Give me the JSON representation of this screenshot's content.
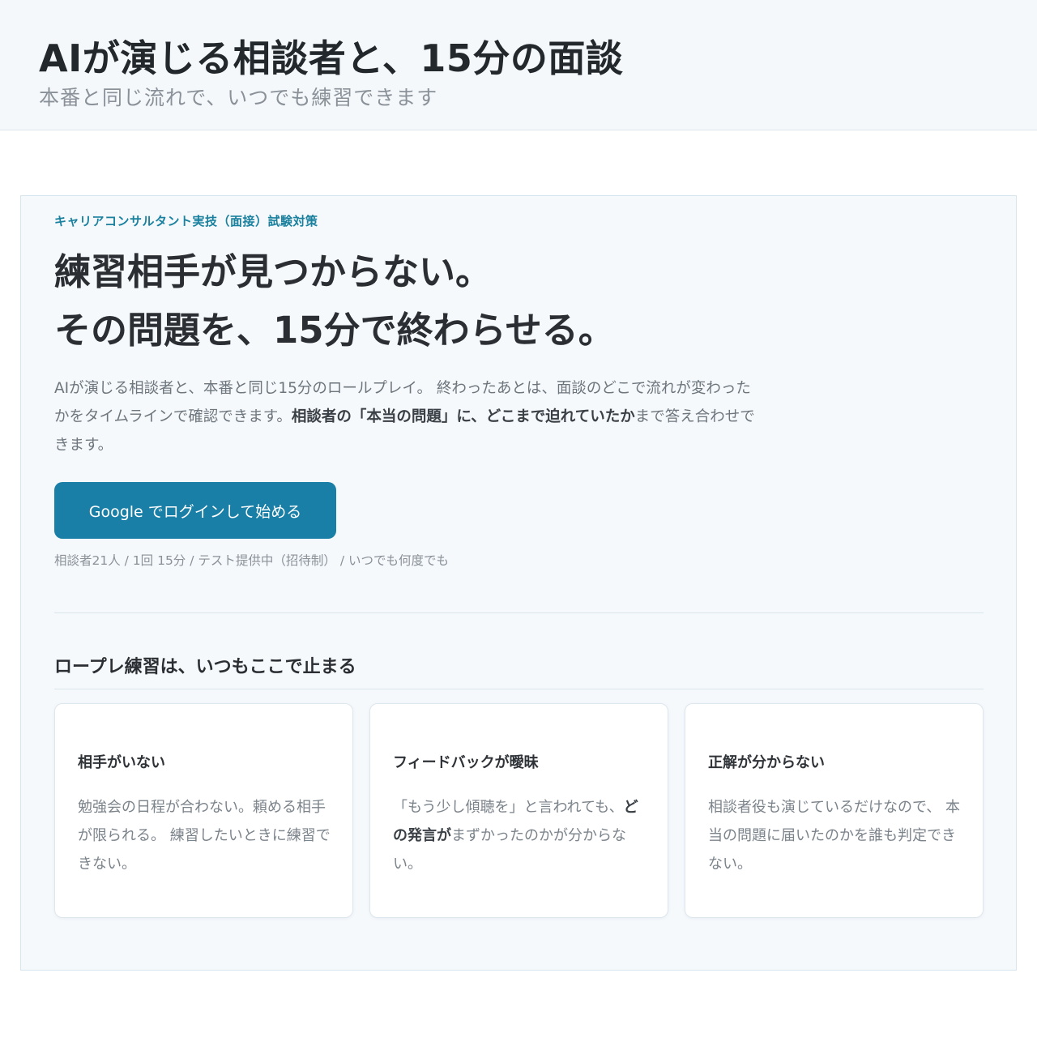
{
  "header": {
    "title": "AIが演じる相談者と、15分の面談",
    "subtitle": "本番と同じ流れで、いつでも練習できます"
  },
  "hero": {
    "eyebrow": "キャリアコンサルタント実技（面接）試験対策",
    "headline_line1": "練習相手が見つからない。",
    "headline_line2": "その問題を、15分で終わらせる。",
    "description": {
      "part1": "AIが演じる相談者と、本番と同じ15分のロールプレイ。 終わったあとは、面談のどこで流れが変わったかをタイムラインで確認できます。",
      "bold": "相談者の「本当の問題」に、どこまで迫れていたか",
      "part2": "まで答え合わせできます。"
    },
    "cta_label": "Google でログインして始める",
    "meta": "相談者21人 / 1回 15分 / テスト提供中（招待制） / いつでも何度でも"
  },
  "problems": {
    "section_title": "ロープレ練習は、いつもここで止まる",
    "cards": [
      {
        "title": "相手がいない",
        "body_pre": "勉強会の日程が合わない。頼める相手が限られる。 練習したいときに練習できない。",
        "body_bold": "",
        "body_post": ""
      },
      {
        "title": "フィードバックが曖昧",
        "body_pre": "「もう少し傾聴を」と言われても、",
        "body_bold": "どの発言が",
        "body_post": "まずかったのかが分からない。"
      },
      {
        "title": "正解が分からない",
        "body_pre": "相談者役も演じているだけなので、 本当の問題に届いたのかを誰も判定できない。",
        "body_bold": "",
        "body_post": ""
      }
    ]
  }
}
